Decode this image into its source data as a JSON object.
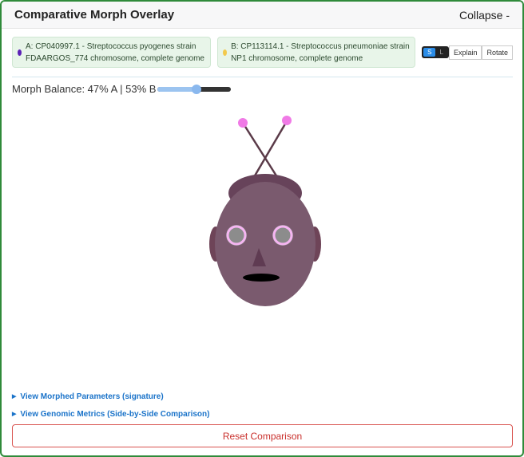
{
  "header": {
    "title": "Comparative Morph Overlay",
    "collapse_label": "Collapse -"
  },
  "genomes": {
    "a": {
      "label": "A: CP040997.1 - Streptococcus pyogenes strain FDAARGOS_774 chromosome, complete genome",
      "color": "#5b21b6"
    },
    "b": {
      "label": "B: CP113114.1 - Streptococcus pneumoniae strain NP1 chromosome, complete genome",
      "color": "#f2c94c"
    }
  },
  "controls": {
    "s_label": "S",
    "l_label": "L",
    "explain_label": "Explain",
    "rotate_label": "Rotate"
  },
  "morph": {
    "label": "Morph Balance: 47% A | 53% B",
    "balance_b_percent": 53
  },
  "details": [
    {
      "label": "View Morphed Parameters (signature)"
    },
    {
      "label": "View Genomic Metrics (Side-by-Side Comparison)"
    }
  ],
  "reset_label": "Reset Comparison"
}
